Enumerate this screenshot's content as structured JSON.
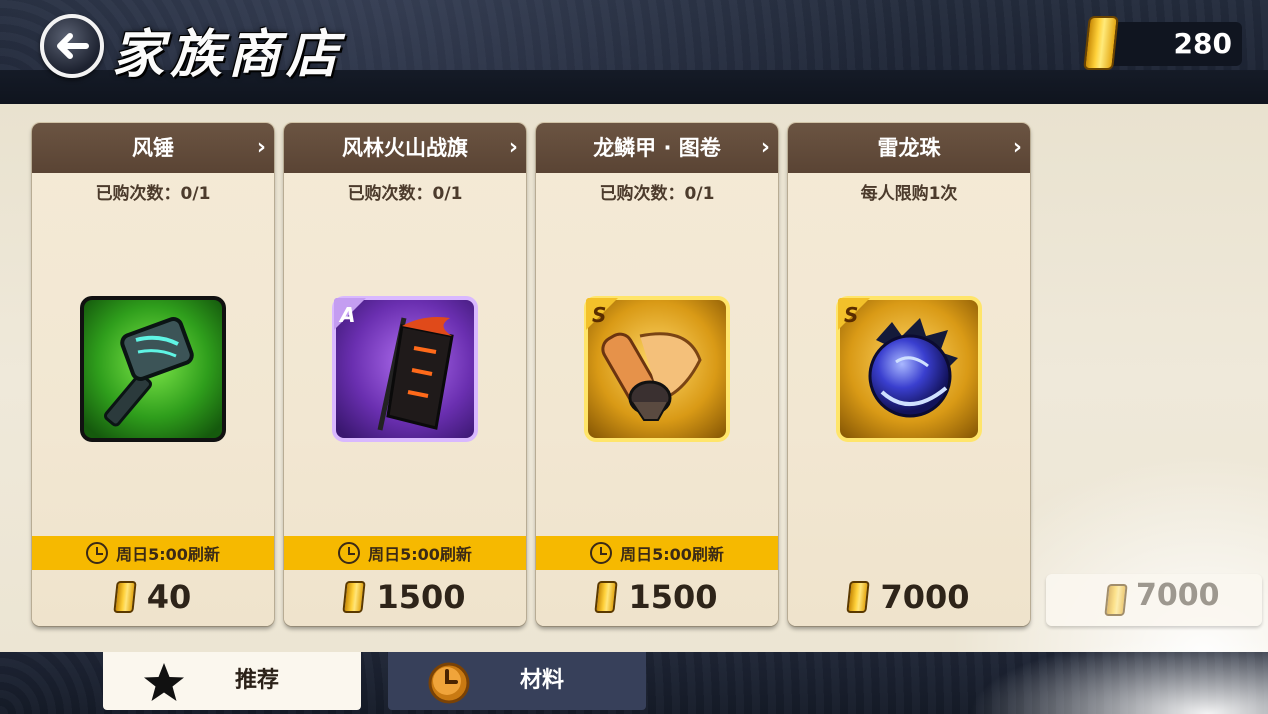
{
  "header": {
    "title": "家族商店",
    "currency_amount": "280"
  },
  "items": [
    {
      "name": "风锤",
      "purchase_info": "已购次数：0/1",
      "refresh": "周日5:00刷新",
      "price": "40",
      "grade": ""
    },
    {
      "name": "风林火山战旗",
      "purchase_info": "已购次数：0/1",
      "refresh": "周日5:00刷新",
      "price": "1500",
      "grade": "A"
    },
    {
      "name": "龙鳞甲 · 图卷",
      "purchase_info": "已购次数：0/1",
      "refresh": "周日5:00刷新",
      "price": "1500",
      "grade": "S"
    },
    {
      "name": "雷龙珠",
      "purchase_info": "每人限购1次",
      "refresh": "",
      "price": "7000",
      "grade": "S"
    }
  ],
  "partial_item": {
    "price": "7000"
  },
  "tabs": [
    {
      "label": "推荐",
      "icon": "star-icon",
      "active": true
    },
    {
      "label": "材料",
      "icon": "clock-coin-icon",
      "active": false
    }
  ],
  "colors": {
    "card_header": "#5e4838",
    "refresh_bar": "#f6b900",
    "gold": "#ffd13a",
    "active_tab": "#fbf7ee",
    "inactive_tab": "#37405a"
  }
}
